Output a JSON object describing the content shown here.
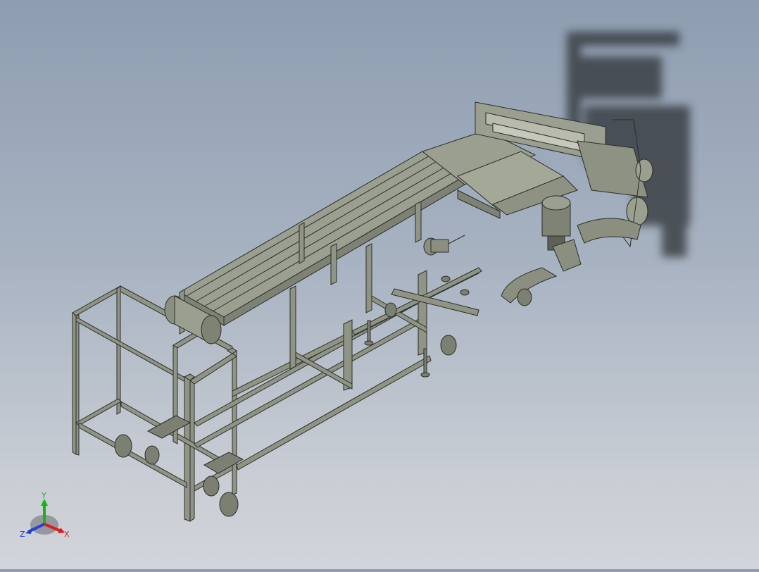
{
  "viewport": {
    "background_top": "#8e9db1",
    "background_bottom": "#d2d5da",
    "model_color": "#8f9485",
    "edge_color": "#2b2d2a",
    "shadow_color": "#2e3236"
  },
  "triad": {
    "x_label": "X",
    "y_label": "Y",
    "z_label": "Z",
    "x_color": "#d62020",
    "y_color": "#19b319",
    "z_color": "#2040d8"
  }
}
